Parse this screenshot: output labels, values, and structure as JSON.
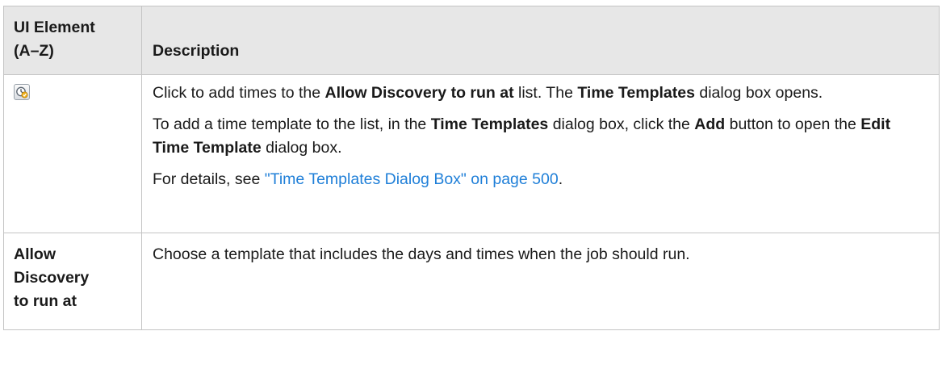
{
  "table": {
    "header": {
      "element_line1": "UI Element",
      "element_line2": "(A–Z)",
      "description": "Description"
    },
    "rows": [
      {
        "element_icon": "add-time-clock-icon",
        "p1": {
          "t1": "Click to add times to the ",
          "b1": "Allow Discovery to run at",
          "t2": " list. The ",
          "b2": "Time Templates",
          "t3": " dialog box opens."
        },
        "p2": {
          "t1": "To add a time template to the list, in the ",
          "b1": "Time Templates",
          "t2": " dialog box, click the ",
          "b2": "Add",
          "t3": " button to open the ",
          "b3": "Edit Time Template",
          "t4": " dialog box."
        },
        "p3": {
          "t1": "For details, see ",
          "link": "\"Time Templates Dialog Box\" on page 500",
          "t2": "."
        }
      },
      {
        "element_line1": "Allow",
        "element_line2": "Discovery",
        "element_line3": "to run at",
        "description": "Choose a template that includes the days and times when the job should run."
      }
    ]
  },
  "colors": {
    "header_bg": "#e7e7e7",
    "border": "#c4c4c4",
    "link": "#1f7fd8"
  }
}
